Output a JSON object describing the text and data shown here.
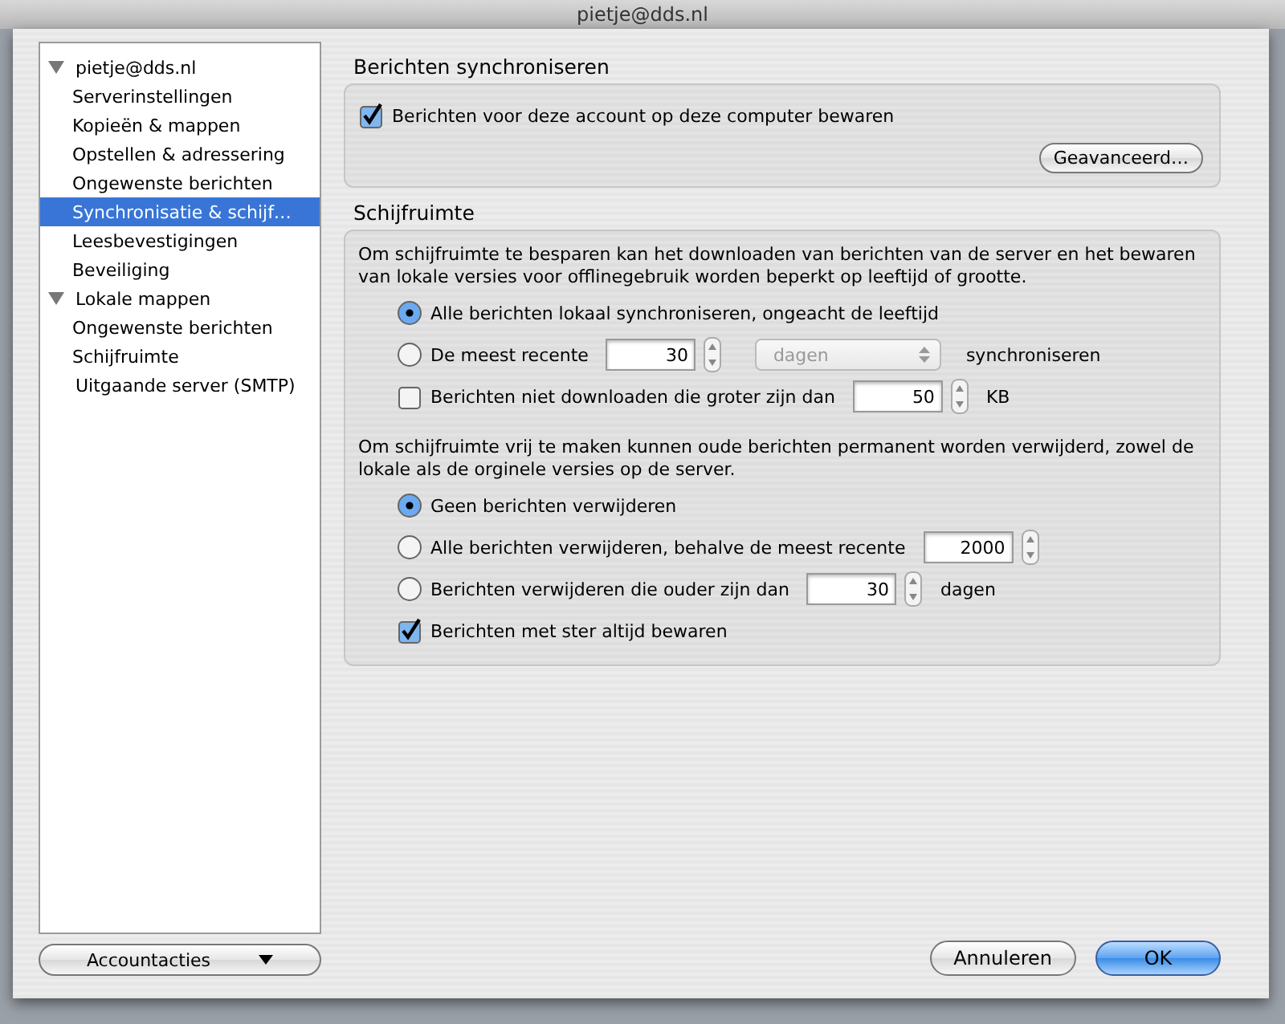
{
  "window": {
    "title": "pietje@dds.nl"
  },
  "tree": [
    {
      "label": "pietje@dds.nl",
      "expanded": true,
      "selected": false,
      "children": [
        {
          "label": "Serverinstellingen",
          "selected": false
        },
        {
          "label": "Kopieën & mappen",
          "selected": false
        },
        {
          "label": "Opstellen & adressering",
          "selected": false
        },
        {
          "label": "Ongewenste berichten",
          "selected": false
        },
        {
          "label": "Synchronisatie & schijf…",
          "selected": true
        },
        {
          "label": "Leesbevestigingen",
          "selected": false
        },
        {
          "label": "Beveiliging",
          "selected": false
        }
      ]
    },
    {
      "label": "Lokale mappen",
      "expanded": true,
      "selected": false,
      "children": [
        {
          "label": "Ongewenste berichten",
          "selected": false
        },
        {
          "label": "Schijfruimte",
          "selected": false
        }
      ]
    },
    {
      "label": "Uitgaande server (SMTP)",
      "selected": false
    }
  ],
  "account_actions": {
    "label": "Accountacties"
  },
  "sync": {
    "title": "Berichten synchroniseren",
    "option": {
      "label": "Berichten voor deze account op deze computer bewaren",
      "checked": true
    },
    "button": "Geavanceerd…"
  },
  "disk": {
    "title": "Schijfruimte",
    "groups": [
      {
        "description": "Om schijfruimte te besparen kan het downloaden van berichten van de server en het bewaren van lokale versies voor offlinegebruik worden beperkt op leeftijd of grootte.",
        "options": [
          {
            "kind": "radio",
            "label": "Alle berichten lokaal synchroniseren, ongeacht de leeftijd",
            "selected": true
          },
          {
            "kind": "radio",
            "label": "De meest recente",
            "selected": false,
            "number": "30",
            "unit": {
              "value": "dagen",
              "disabled": true
            },
            "suffix": "synchroniseren"
          },
          {
            "kind": "checkbox",
            "label": "Berichten niet downloaden die groter zijn dan",
            "checked": false,
            "number": "50",
            "suffix": "KB"
          }
        ]
      },
      {
        "description": "Om schijfruimte vrij te maken kunnen oude berichten permanent worden verwijderd, zowel de lokale als de orginele versies op de server.",
        "options": [
          {
            "kind": "radio",
            "label": "Geen berichten verwijderen",
            "selected": true
          },
          {
            "kind": "radio",
            "label": "Alle berichten verwijderen, behalve de meest recente",
            "selected": false,
            "number": "2000"
          },
          {
            "kind": "radio",
            "label": "Berichten verwijderen die ouder zijn dan",
            "selected": false,
            "number": "30",
            "suffix": "dagen"
          },
          {
            "kind": "checkbox",
            "label": "Berichten met ster altijd bewaren",
            "checked": true
          }
        ]
      }
    ]
  },
  "buttons": [
    {
      "label": "Annuleren",
      "default": false
    },
    {
      "label": "OK",
      "default": true
    }
  ]
}
